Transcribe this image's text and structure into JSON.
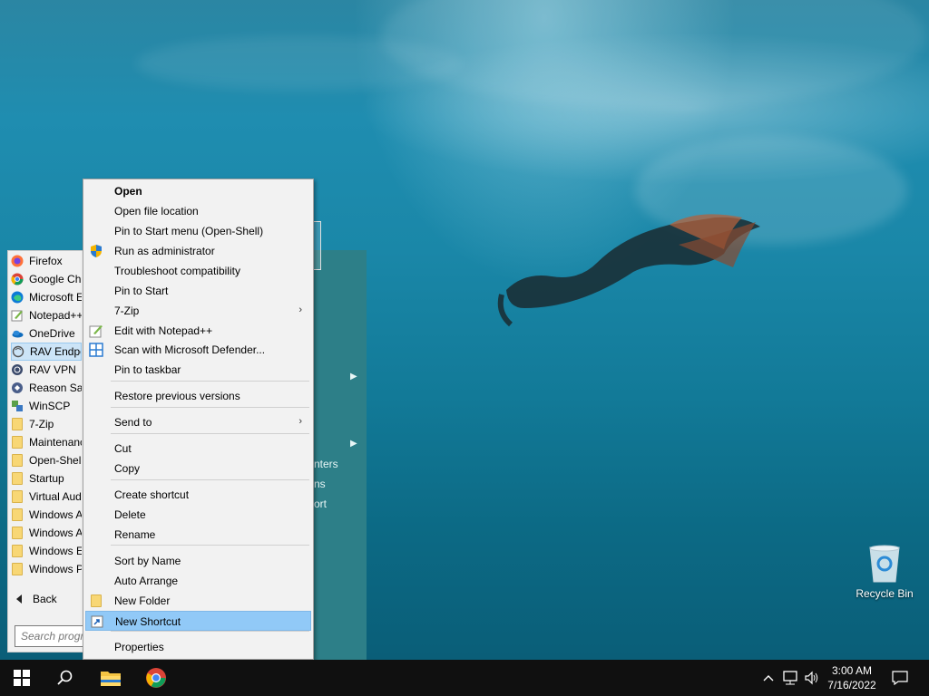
{
  "desktop": {
    "recycle_bin_label": "Recycle Bin"
  },
  "start_menu": {
    "programs": [
      {
        "label": "Firefox",
        "icon": "firefox-icon"
      },
      {
        "label": "Google Chrome",
        "icon": "chrome-icon"
      },
      {
        "label": "Microsoft Edge",
        "icon": "edge-icon"
      },
      {
        "label": "Notepad++",
        "icon": "notepad-plus-plus-icon"
      },
      {
        "label": "OneDrive",
        "icon": "onedrive-icon"
      },
      {
        "label": "RAV Endpoint Protection",
        "icon": "rav-endpoint-icon"
      },
      {
        "label": "RAV VPN",
        "icon": "rav-vpn-icon"
      },
      {
        "label": "Reason Safer Web",
        "icon": "reason-icon"
      },
      {
        "label": "WinSCP",
        "icon": "winscp-icon"
      },
      {
        "label": "7-Zip",
        "icon": "folder-icon"
      },
      {
        "label": "Maintenance",
        "icon": "folder-icon"
      },
      {
        "label": "Open-Shell",
        "icon": "folder-icon"
      },
      {
        "label": "Startup",
        "icon": "folder-icon"
      },
      {
        "label": "Virtual Audio Cable",
        "icon": "folder-icon"
      },
      {
        "label": "Windows Accessories",
        "icon": "folder-icon"
      },
      {
        "label": "Windows Administrative Tools",
        "icon": "folder-icon"
      },
      {
        "label": "Windows Ease of Access",
        "icon": "folder-icon"
      },
      {
        "label": "Windows PowerShell",
        "icon": "folder-icon"
      }
    ],
    "back_label": "Back",
    "search_placeholder": "Search programs and files",
    "right_items": [
      "nters",
      "ns",
      "ort"
    ]
  },
  "context_menu": {
    "items": [
      {
        "label": "Open",
        "bold": true
      },
      {
        "label": "Open file location"
      },
      {
        "label": "Pin to Start menu (Open-Shell)"
      },
      {
        "label": "Run as administrator",
        "icon": "uac-shield-icon"
      },
      {
        "label": "Troubleshoot compatibility"
      },
      {
        "label": "Pin to Start"
      },
      {
        "label": "7-Zip",
        "submenu": true
      },
      {
        "label": "Edit with Notepad++",
        "icon": "notepad-plus-plus-icon"
      },
      {
        "label": "Scan with Microsoft Defender...",
        "icon": "defender-icon"
      },
      {
        "label": "Pin to taskbar"
      },
      {
        "label": "Restore previous versions"
      },
      {
        "label": "Send to",
        "submenu": true
      },
      {
        "label": "Cut"
      },
      {
        "label": "Copy"
      },
      {
        "label": "Create shortcut"
      },
      {
        "label": "Delete"
      },
      {
        "label": "Rename"
      },
      {
        "label": "Sort by Name"
      },
      {
        "label": "Auto Arrange"
      },
      {
        "label": "New Folder",
        "icon": "folder-icon"
      },
      {
        "label": "New Shortcut",
        "icon": "shortcut-icon",
        "highlighted": true
      },
      {
        "label": "Properties"
      }
    ],
    "submenu_arrow": "›"
  },
  "taskbar": {
    "time": "3:00 AM",
    "date": "7/16/2022",
    "icons": [
      "windows-start-icon",
      "search-icon",
      "file-explorer-icon",
      "chrome-icon"
    ],
    "tray_icons": [
      "chevron-up-icon",
      "network-icon",
      "volume-icon",
      "notification-icon"
    ]
  }
}
